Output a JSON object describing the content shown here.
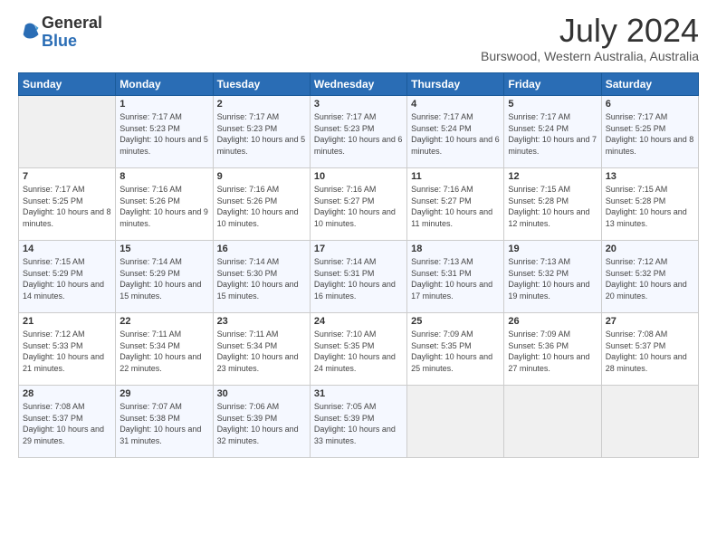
{
  "header": {
    "logo_general": "General",
    "logo_blue": "Blue",
    "month_title": "July 2024",
    "location": "Burswood, Western Australia, Australia"
  },
  "days_of_week": [
    "Sunday",
    "Monday",
    "Tuesday",
    "Wednesday",
    "Thursday",
    "Friday",
    "Saturday"
  ],
  "weeks": [
    [
      {
        "day": "",
        "sunrise": "",
        "sunset": "",
        "daylight": ""
      },
      {
        "day": "1",
        "sunrise": "Sunrise: 7:17 AM",
        "sunset": "Sunset: 5:23 PM",
        "daylight": "Daylight: 10 hours and 5 minutes."
      },
      {
        "day": "2",
        "sunrise": "Sunrise: 7:17 AM",
        "sunset": "Sunset: 5:23 PM",
        "daylight": "Daylight: 10 hours and 5 minutes."
      },
      {
        "day": "3",
        "sunrise": "Sunrise: 7:17 AM",
        "sunset": "Sunset: 5:23 PM",
        "daylight": "Daylight: 10 hours and 6 minutes."
      },
      {
        "day": "4",
        "sunrise": "Sunrise: 7:17 AM",
        "sunset": "Sunset: 5:24 PM",
        "daylight": "Daylight: 10 hours and 6 minutes."
      },
      {
        "day": "5",
        "sunrise": "Sunrise: 7:17 AM",
        "sunset": "Sunset: 5:24 PM",
        "daylight": "Daylight: 10 hours and 7 minutes."
      },
      {
        "day": "6",
        "sunrise": "Sunrise: 7:17 AM",
        "sunset": "Sunset: 5:25 PM",
        "daylight": "Daylight: 10 hours and 8 minutes."
      }
    ],
    [
      {
        "day": "7",
        "sunrise": "Sunrise: 7:17 AM",
        "sunset": "Sunset: 5:25 PM",
        "daylight": "Daylight: 10 hours and 8 minutes."
      },
      {
        "day": "8",
        "sunrise": "Sunrise: 7:16 AM",
        "sunset": "Sunset: 5:26 PM",
        "daylight": "Daylight: 10 hours and 9 minutes."
      },
      {
        "day": "9",
        "sunrise": "Sunrise: 7:16 AM",
        "sunset": "Sunset: 5:26 PM",
        "daylight": "Daylight: 10 hours and 10 minutes."
      },
      {
        "day": "10",
        "sunrise": "Sunrise: 7:16 AM",
        "sunset": "Sunset: 5:27 PM",
        "daylight": "Daylight: 10 hours and 10 minutes."
      },
      {
        "day": "11",
        "sunrise": "Sunrise: 7:16 AM",
        "sunset": "Sunset: 5:27 PM",
        "daylight": "Daylight: 10 hours and 11 minutes."
      },
      {
        "day": "12",
        "sunrise": "Sunrise: 7:15 AM",
        "sunset": "Sunset: 5:28 PM",
        "daylight": "Daylight: 10 hours and 12 minutes."
      },
      {
        "day": "13",
        "sunrise": "Sunrise: 7:15 AM",
        "sunset": "Sunset: 5:28 PM",
        "daylight": "Daylight: 10 hours and 13 minutes."
      }
    ],
    [
      {
        "day": "14",
        "sunrise": "Sunrise: 7:15 AM",
        "sunset": "Sunset: 5:29 PM",
        "daylight": "Daylight: 10 hours and 14 minutes."
      },
      {
        "day": "15",
        "sunrise": "Sunrise: 7:14 AM",
        "sunset": "Sunset: 5:29 PM",
        "daylight": "Daylight: 10 hours and 15 minutes."
      },
      {
        "day": "16",
        "sunrise": "Sunrise: 7:14 AM",
        "sunset": "Sunset: 5:30 PM",
        "daylight": "Daylight: 10 hours and 15 minutes."
      },
      {
        "day": "17",
        "sunrise": "Sunrise: 7:14 AM",
        "sunset": "Sunset: 5:31 PM",
        "daylight": "Daylight: 10 hours and 16 minutes."
      },
      {
        "day": "18",
        "sunrise": "Sunrise: 7:13 AM",
        "sunset": "Sunset: 5:31 PM",
        "daylight": "Daylight: 10 hours and 17 minutes."
      },
      {
        "day": "19",
        "sunrise": "Sunrise: 7:13 AM",
        "sunset": "Sunset: 5:32 PM",
        "daylight": "Daylight: 10 hours and 19 minutes."
      },
      {
        "day": "20",
        "sunrise": "Sunrise: 7:12 AM",
        "sunset": "Sunset: 5:32 PM",
        "daylight": "Daylight: 10 hours and 20 minutes."
      }
    ],
    [
      {
        "day": "21",
        "sunrise": "Sunrise: 7:12 AM",
        "sunset": "Sunset: 5:33 PM",
        "daylight": "Daylight: 10 hours and 21 minutes."
      },
      {
        "day": "22",
        "sunrise": "Sunrise: 7:11 AM",
        "sunset": "Sunset: 5:34 PM",
        "daylight": "Daylight: 10 hours and 22 minutes."
      },
      {
        "day": "23",
        "sunrise": "Sunrise: 7:11 AM",
        "sunset": "Sunset: 5:34 PM",
        "daylight": "Daylight: 10 hours and 23 minutes."
      },
      {
        "day": "24",
        "sunrise": "Sunrise: 7:10 AM",
        "sunset": "Sunset: 5:35 PM",
        "daylight": "Daylight: 10 hours and 24 minutes."
      },
      {
        "day": "25",
        "sunrise": "Sunrise: 7:09 AM",
        "sunset": "Sunset: 5:35 PM",
        "daylight": "Daylight: 10 hours and 25 minutes."
      },
      {
        "day": "26",
        "sunrise": "Sunrise: 7:09 AM",
        "sunset": "Sunset: 5:36 PM",
        "daylight": "Daylight: 10 hours and 27 minutes."
      },
      {
        "day": "27",
        "sunrise": "Sunrise: 7:08 AM",
        "sunset": "Sunset: 5:37 PM",
        "daylight": "Daylight: 10 hours and 28 minutes."
      }
    ],
    [
      {
        "day": "28",
        "sunrise": "Sunrise: 7:08 AM",
        "sunset": "Sunset: 5:37 PM",
        "daylight": "Daylight: 10 hours and 29 minutes."
      },
      {
        "day": "29",
        "sunrise": "Sunrise: 7:07 AM",
        "sunset": "Sunset: 5:38 PM",
        "daylight": "Daylight: 10 hours and 31 minutes."
      },
      {
        "day": "30",
        "sunrise": "Sunrise: 7:06 AM",
        "sunset": "Sunset: 5:39 PM",
        "daylight": "Daylight: 10 hours and 32 minutes."
      },
      {
        "day": "31",
        "sunrise": "Sunrise: 7:05 AM",
        "sunset": "Sunset: 5:39 PM",
        "daylight": "Daylight: 10 hours and 33 minutes."
      },
      {
        "day": "",
        "sunrise": "",
        "sunset": "",
        "daylight": ""
      },
      {
        "day": "",
        "sunrise": "",
        "sunset": "",
        "daylight": ""
      },
      {
        "day": "",
        "sunrise": "",
        "sunset": "",
        "daylight": ""
      }
    ]
  ]
}
